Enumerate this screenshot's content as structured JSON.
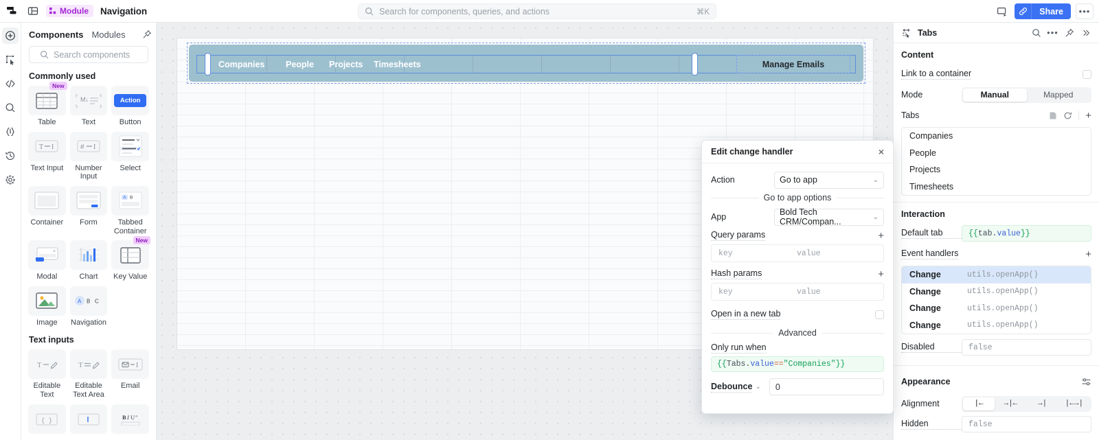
{
  "topbar": {
    "module_badge": "Module",
    "title": "Navigation",
    "search_placeholder": "Search for components, queries, and actions",
    "search_shortcut": "⌘K",
    "share_label": "Share",
    "more_label": "•••"
  },
  "rail": {
    "items": [
      {
        "name": "add-icon"
      },
      {
        "name": "select-tool-icon"
      },
      {
        "name": "code-icon"
      },
      {
        "name": "search-icon"
      },
      {
        "name": "state-icon"
      },
      {
        "name": "history-icon"
      },
      {
        "name": "gear-icon"
      }
    ]
  },
  "components_panel": {
    "tab_components": "Components",
    "tab_modules": "Modules",
    "search_placeholder": "Search components",
    "sections": [
      {
        "title": "Commonly used",
        "items": [
          {
            "label": "Table",
            "badge": "New",
            "icon": "table-icon"
          },
          {
            "label": "Text",
            "badge": "",
            "icon": "text-icon"
          },
          {
            "label": "Button",
            "badge": "",
            "icon": "button-icon",
            "button_text": "Action"
          },
          {
            "label": "Text Input",
            "badge": "",
            "icon": "text-input-icon"
          },
          {
            "label": "Number Input",
            "badge": "",
            "icon": "number-input-icon"
          },
          {
            "label": "Select",
            "badge": "",
            "icon": "select-icon"
          },
          {
            "label": "Container",
            "badge": "",
            "icon": "container-icon"
          },
          {
            "label": "Form",
            "badge": "",
            "icon": "form-icon"
          },
          {
            "label": "Tabbed Container",
            "badge": "",
            "icon": "tabbed-container-icon"
          },
          {
            "label": "Modal",
            "badge": "",
            "icon": "modal-icon"
          },
          {
            "label": "Chart",
            "badge": "",
            "icon": "chart-icon"
          },
          {
            "label": "Key Value",
            "badge": "New",
            "icon": "key-value-icon"
          },
          {
            "label": "Image",
            "badge": "",
            "icon": "image-icon"
          },
          {
            "label": "Navigation",
            "badge": "",
            "icon": "navigation-icon"
          }
        ]
      },
      {
        "title": "Text inputs",
        "items": [
          {
            "label": "Editable Text",
            "badge": "",
            "icon": "editable-text-icon"
          },
          {
            "label": "Editable Text Area",
            "badge": "",
            "icon": "editable-text-area-icon"
          },
          {
            "label": "Email",
            "badge": "",
            "icon": "email-icon"
          }
        ]
      }
    ]
  },
  "canvas": {
    "nav_tabs": [
      "Companies",
      "People",
      "Projects",
      "Timesheets"
    ],
    "nav_action": "Manage Emails"
  },
  "modal": {
    "title": "Edit change handler",
    "action_label": "Action",
    "action_value": "Go to app",
    "options_divider": "Go to app options",
    "app_label": "App",
    "app_value": "Bold Tech CRM/Compan...",
    "query_params_label": "Query params",
    "hash_params_label": "Hash params",
    "kv_key_placeholder": "key",
    "kv_value_placeholder": "value",
    "new_tab_label": "Open in a new tab",
    "advanced_divider": "Advanced",
    "only_run_when_label": "Only run when",
    "only_run_when_code": {
      "open": "{{",
      "obj": "Tabs",
      "dot": ".",
      "prop": "value",
      "op": " == ",
      "str": "\"Companies\"",
      "close": "}}"
    },
    "debounce_label": "Debounce",
    "debounce_value": "0",
    "add_label": "+"
  },
  "right_panel": {
    "header_title": "Tabs",
    "content": {
      "section_title": "Content",
      "link_container_label": "Link to a container",
      "mode_label": "Mode",
      "mode_options": [
        "Manual",
        "Mapped"
      ],
      "mode_selected": "Manual",
      "tabs_label": "Tabs",
      "tabs_items": [
        "Companies",
        "People",
        "Projects",
        "Timesheets"
      ]
    },
    "interaction": {
      "section_title": "Interaction",
      "default_tab_label": "Default tab",
      "default_tab_code": {
        "open": "{{",
        "obj": "tab",
        "dot": ".",
        "prop": "value",
        "close": "}}"
      },
      "event_handlers_label": "Event handlers",
      "event_handlers": [
        {
          "name": "Change",
          "value": "utils.openApp()",
          "selected": true
        },
        {
          "name": "Change",
          "value": "utils.openApp()",
          "selected": false
        },
        {
          "name": "Change",
          "value": "utils.openApp()",
          "selected": false
        },
        {
          "name": "Change",
          "value": "utils.openApp()",
          "selected": false
        }
      ],
      "disabled_label": "Disabled",
      "disabled_value": "false"
    },
    "appearance": {
      "section_title": "Appearance",
      "alignment_label": "Alignment",
      "alignment_options": [
        "|←",
        "→|←",
        "→|",
        "|←→|"
      ],
      "alignment_selected": "|←",
      "hidden_label": "Hidden",
      "hidden_value": "false"
    }
  },
  "colors": {
    "accent": "#3b72f4",
    "module_badge_bg": "#f7e8fd",
    "module_badge_fg": "#a425d6",
    "nav_component": "#9dc0cf",
    "selection_blue": "#5b8ddb",
    "code_green_bg": "#effbf3",
    "event_selected": "#d9e7fa"
  }
}
